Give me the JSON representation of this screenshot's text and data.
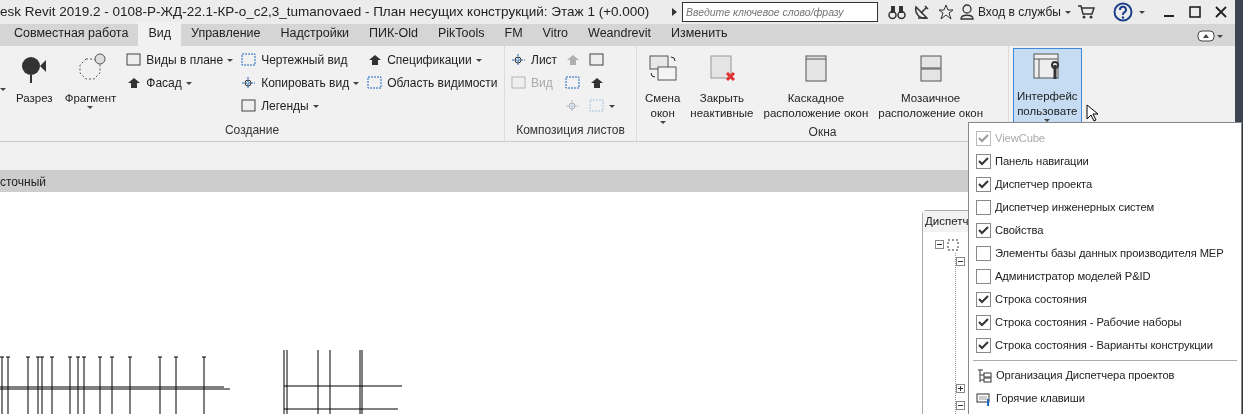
{
  "window": {
    "title": "esk Revit 2019.2 - 0108-Р-ЖД-22.1-КР-о_c2,3_tumanovaed - План несущих конструкций: Этаж 1 (+0.000)",
    "search": {
      "placeholder": "Введите ключевое слово/фразу"
    },
    "sign_in": "Вход в службы"
  },
  "tabs": [
    {
      "label": "Совместная работа",
      "selected": false
    },
    {
      "label": "Вид",
      "selected": true
    },
    {
      "label": "Управление",
      "selected": false
    },
    {
      "label": "Надстройки",
      "selected": false
    },
    {
      "label": "ПИК-Old",
      "selected": false
    },
    {
      "label": "PikTools",
      "selected": false
    },
    {
      "label": "FM",
      "selected": false
    },
    {
      "label": "Vitro",
      "selected": false
    },
    {
      "label": "Weandrevit",
      "selected": false
    },
    {
      "label": "Изменить",
      "selected": false
    }
  ],
  "ribbon": {
    "panels": [
      {
        "title": "Создание",
        "items": [
          {
            "kind": "large",
            "dropdown": true
          },
          {
            "kind": "large",
            "label": "Разрез",
            "dropdown": false
          },
          {
            "kind": "large",
            "label": "Фрагмент",
            "dropdown": true
          },
          {
            "kind": "stack",
            "buttons": [
              {
                "label": "Виды в плане",
                "dropdown": true,
                "disabled": false
              },
              {
                "label": "Фасад",
                "dropdown": true,
                "disabled": false
              }
            ]
          },
          {
            "kind": "stack",
            "buttons": [
              {
                "label": "Чертежный вид",
                "dropdown": false,
                "disabled": false
              },
              {
                "label": "Копировать вид",
                "dropdown": true,
                "disabled": false
              },
              {
                "label": "Легенды",
                "dropdown": true,
                "disabled": false
              }
            ]
          },
          {
            "kind": "stack",
            "buttons": [
              {
                "label": "Спецификации",
                "dropdown": true,
                "disabled": false
              },
              {
                "label": "Область видимости",
                "dropdown": false,
                "disabled": false
              }
            ]
          }
        ]
      },
      {
        "title": "Композиция листов",
        "items": [
          {
            "kind": "stack",
            "buttons": [
              {
                "label": "Лист",
                "dropdown": false,
                "disabled": false
              },
              {
                "label": "Вид",
                "dropdown": false,
                "disabled": true
              }
            ]
          },
          {
            "kind": "stack",
            "buttons": [
              {
                "dropdown": false,
                "disabled": true
              },
              {
                "dropdown": false,
                "disabled": false
              },
              {
                "dropdown": false,
                "disabled": true
              }
            ]
          },
          {
            "kind": "stack",
            "buttons": [
              {
                "dropdown": false,
                "disabled": false
              },
              {
                "dropdown": false,
                "disabled": false
              },
              {
                "dropdown": true,
                "disabled": true
              }
            ]
          }
        ]
      },
      {
        "title": "Окна",
        "items": [
          {
            "kind": "large",
            "label": "Смена\nокон",
            "dropdown": true
          },
          {
            "kind": "large",
            "label": "Закрыть\nнеактивные",
            "dropdown": false
          },
          {
            "kind": "large",
            "label": "Каскадное\nрасположение окон",
            "dropdown": false
          },
          {
            "kind": "large",
            "label": "Мозаичное\nрасположение окон",
            "dropdown": false
          }
        ]
      },
      {
        "items": [
          {
            "kind": "large",
            "label": "Интерфейс\nпользовате",
            "dropdown": true,
            "pressed": true
          }
        ]
      }
    ]
  },
  "view_tab": "сточный",
  "project_browser": {
    "title": "Диспетч",
    "tree": [
      {
        "expanded": true,
        "children": [
          {
            "expanded": true
          },
          {
            "expanded": false
          },
          {
            "expanded": true
          }
        ]
      }
    ]
  },
  "menu": [
    {
      "kind": "check",
      "label": "ViewCube",
      "checked": true,
      "disabled": true
    },
    {
      "kind": "check",
      "label": "Панель навигации",
      "checked": true,
      "disabled": false
    },
    {
      "kind": "check",
      "label": "Диспетчер проекта",
      "checked": true,
      "disabled": false
    },
    {
      "kind": "check",
      "label": "Диспетчер инженерных систем",
      "checked": false,
      "disabled": false
    },
    {
      "kind": "check",
      "label": "Свойства",
      "checked": true,
      "disabled": false
    },
    {
      "kind": "check",
      "label": "Элементы базы данных производителя MEP",
      "checked": false,
      "disabled": false
    },
    {
      "kind": "check",
      "label": "Администратор моделей P&ID",
      "checked": false,
      "disabled": false
    },
    {
      "kind": "check",
      "label": "Строка состояния",
      "checked": true,
      "disabled": false
    },
    {
      "kind": "check",
      "label": "Строка состояния - Рабочие наборы",
      "checked": true,
      "disabled": false
    },
    {
      "kind": "check",
      "label": "Строка состояния - Варианты конструкции",
      "checked": true,
      "disabled": false
    },
    {
      "kind": "separator"
    },
    {
      "kind": "command",
      "label": "Организация Диспетчера проектов"
    },
    {
      "kind": "command",
      "label": "Горячие клавиши"
    }
  ]
}
